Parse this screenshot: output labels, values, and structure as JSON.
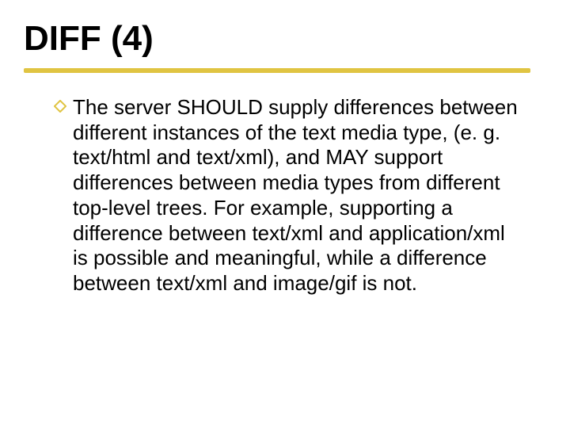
{
  "slide": {
    "title": "DIFF (4)",
    "bullets": [
      {
        "text": "The server SHOULD supply differences between different instances of the text media type, (e. g. text/html and text/xml), and MAY support differences between media types from different top-level trees. For example, supporting a difference between text/xml and application/xml is possible and meaningful, while a difference between text/xml and image/gif is not."
      }
    ],
    "accent_color": "#e0c442"
  }
}
